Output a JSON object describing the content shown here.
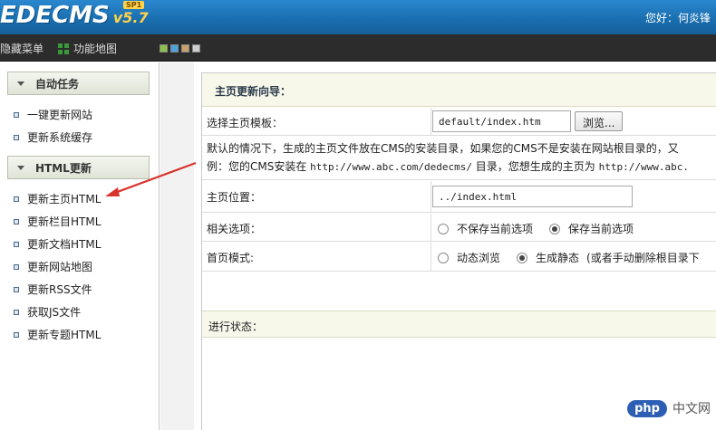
{
  "header": {
    "logo_text": "EDECMS",
    "logo_version": "v5.7",
    "logo_badge": "SP1",
    "greeting": "您好：何炎锋"
  },
  "navbar": {
    "hide_menu": "隐藏菜单",
    "function_map": "功能地图",
    "skin_swatches": [
      "#8bc34a",
      "#4aa3df",
      "#c9a26b",
      "#cfcfcf"
    ]
  },
  "sidebar": {
    "sections": [
      {
        "title": "自动任务",
        "items": [
          "一键更新网站",
          "更新系统缓存"
        ]
      },
      {
        "title": "HTML更新",
        "items": [
          "更新主页HTML",
          "更新栏目HTML",
          "更新文档HTML",
          "更新网站地图",
          "更新RSS文件",
          "获取JS文件",
          "更新专题HTML"
        ]
      }
    ]
  },
  "main": {
    "title": "主页更新向导：",
    "template_label": "选择主页模板：",
    "template_value": "default/index.htm",
    "browse_button": "浏览...",
    "note_line1": "默认的情况下，生成的主页文件放在CMS的安装目录，如果您的CMS不是安装在网站根目录的，又",
    "note_line2_prefix": "例：您的CMS安装在 ",
    "note_line2_url1": "http://www.abc.com/dedecms/",
    "note_line2_mid": " 目录，您想生成的主页为 ",
    "note_line2_url2": "http://www.abc.",
    "location_label": "主页位置：",
    "location_value": "../index.html",
    "options_label": "相关选项：",
    "options": [
      {
        "label": "不保存当前选项",
        "checked": false
      },
      {
        "label": "保存当前选项",
        "checked": true
      }
    ],
    "mode_label": "首页模式:",
    "modes": [
      {
        "label": "动态浏览",
        "checked": false
      },
      {
        "label": "生成静态",
        "checked": true
      }
    ],
    "mode_note": "(或者手动删除根目录下",
    "status_label": "进行状态："
  },
  "watermark": {
    "logo": "php",
    "text": "中文网"
  }
}
